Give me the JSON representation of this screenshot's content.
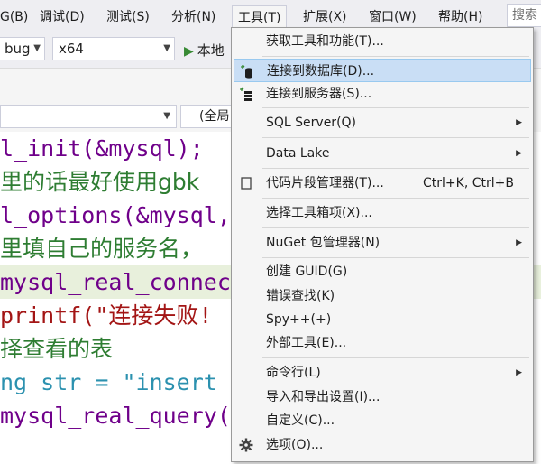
{
  "menubar": {
    "items": [
      "G(B)",
      "调试(D)",
      "测试(S)",
      "分析(N)",
      "工具(T)",
      "扩展(X)",
      "窗口(W)",
      "帮助(H)"
    ],
    "search_label": "搜索"
  },
  "toolbar": {
    "config_value": "bug",
    "platform_value": "x64",
    "run_label": "本地"
  },
  "navbar": {
    "scope_value": "(全局"
  },
  "editor": {
    "lines": [
      "l_init(&mysql);",
      "里的话最好使用gbk",
      "l_options(&mysql,",
      "里填自己的服务名，",
      "mysql_real_connect",
      "printf(\"连接失败!",
      "择查看的表",
      "ng str = \"insert",
      "mysql_real_query(&"
    ]
  },
  "tools_menu": {
    "items": {
      "get_tools": "获取工具和功能(T)...",
      "connect_db": "连接到数据库(D)...",
      "connect_server": "连接到服务器(S)...",
      "sql_server": "SQL Server(Q)",
      "data_lake": "Data Lake",
      "snippets": "代码片段管理器(T)...",
      "snippets_shortcut": "Ctrl+K, Ctrl+B",
      "choose_toolbox": "选择工具箱项(X)...",
      "nuget": "NuGet 包管理器(N)",
      "create_guid": "创建 GUID(G)",
      "error_lookup": "错误查找(K)",
      "spy": "Spy++(+)",
      "external_tools": "外部工具(E)...",
      "command_line": "命令行(L)",
      "import_export": "导入和导出设置(I)...",
      "customize": "自定义(C)...",
      "options": "选项(O)..."
    }
  },
  "colors": {
    "menu_hover": "#c9def5",
    "highlight_line": "#e8f0dc",
    "comment_green": "#2e7d32",
    "string_red": "#a31515",
    "keyword_blue": "#0000ff",
    "identifier_purple": "#6f008a"
  }
}
